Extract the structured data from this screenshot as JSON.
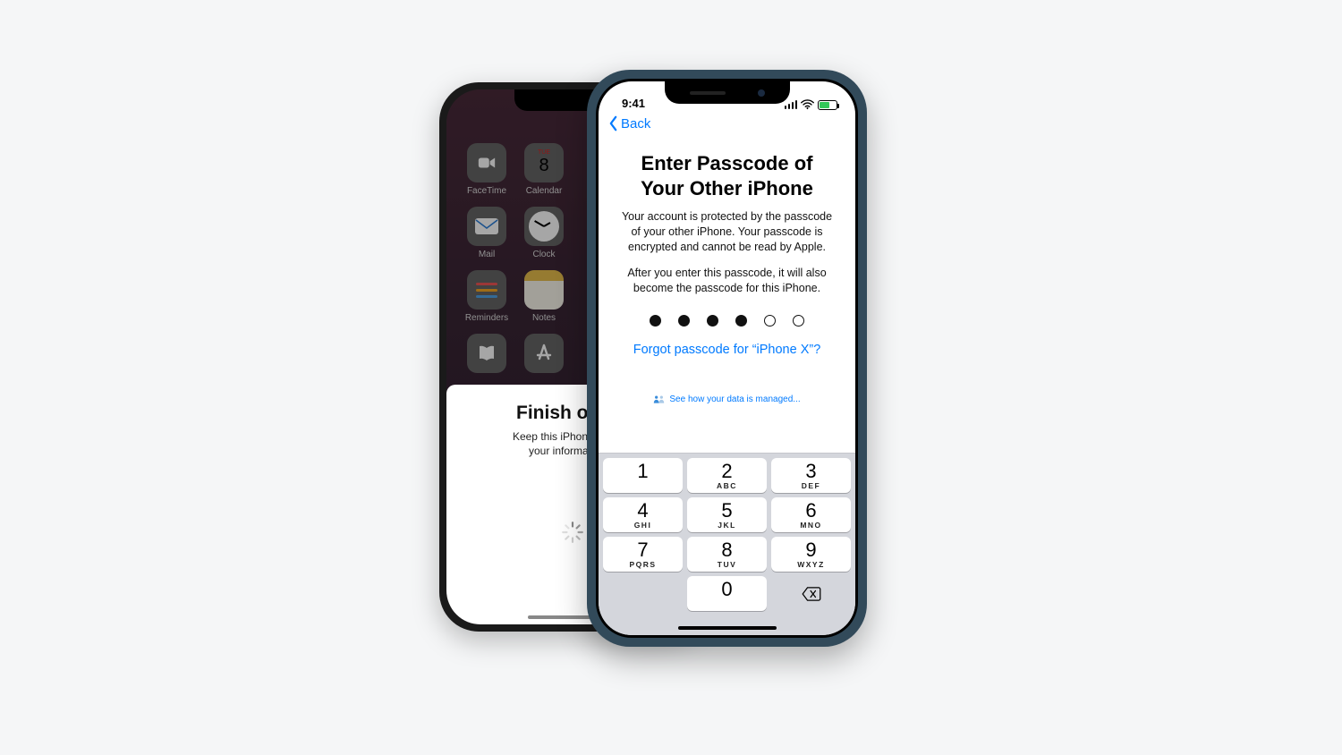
{
  "status": {
    "time": "9:41"
  },
  "nav": {
    "back": "Back"
  },
  "passcode": {
    "title_line1": "Enter Passcode of",
    "title_line2": "Your Other iPhone",
    "para1": "Your account is protected by the passcode of your other iPhone. Your passcode is encrypted and cannot be read by Apple.",
    "para2": "After you enter this passcode, it will also become the passcode for this iPhone.",
    "entered": 4,
    "total": 6,
    "forgot": "Forgot passcode for “iPhone X”?",
    "managed": "See how your data is managed..."
  },
  "keypad": {
    "keys": [
      {
        "n": "1",
        "l": ""
      },
      {
        "n": "2",
        "l": "ABC"
      },
      {
        "n": "3",
        "l": "DEF"
      },
      {
        "n": "4",
        "l": "GHI"
      },
      {
        "n": "5",
        "l": "JKL"
      },
      {
        "n": "6",
        "l": "MNO"
      },
      {
        "n": "7",
        "l": "PQRS"
      },
      {
        "n": "8",
        "l": "TUV"
      },
      {
        "n": "9",
        "l": "WXYZ"
      },
      {
        "n": "0",
        "l": ""
      }
    ]
  },
  "back_phone": {
    "sheet_title": "Finish on Ne",
    "sheet_sub1": "Keep this iPhone near yo",
    "sheet_sub2": "your information is",
    "cal_dow": "TUE",
    "cal_day": "8",
    "apps": {
      "facetime": "FaceTime",
      "calendar": "Calendar",
      "mail": "Mail",
      "clock": "Clock",
      "reminders": "Reminders",
      "notes": "Notes"
    }
  }
}
